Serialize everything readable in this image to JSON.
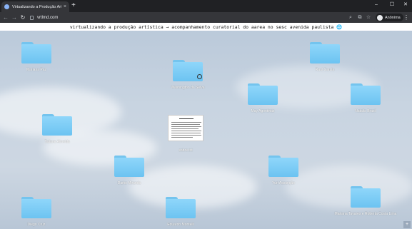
{
  "browser": {
    "tab_title": "Virtualizando a Produção Artística",
    "new_tab_label": "+",
    "close_tab_label": "×",
    "url": "vrtlmd.com",
    "profile_name": "Anônima",
    "window_controls": {
      "minimize": "–",
      "maximize": "☐",
      "close": "✕"
    },
    "nav_icons": {
      "back": "←",
      "forward": "→",
      "reload": "↻"
    },
    "toolbar_icons": {
      "search": "⌕",
      "cast": "⧉",
      "bookmark": "☆",
      "menu": "⋮"
    }
  },
  "page": {
    "banner_text": "virtualizando a produção artística → acompanhamento curatorial do aarea no sesc avenida paulista 🌐",
    "folders": [
      "Mariana Paz",
      "Washington da Selva",
      "Raul Garcia",
      "May Agontinas",
      "Natalia Brasil",
      "Tatiane Almeida",
      "Darks Miranda",
      "Yuri Assunção",
      "Mariana Tavares e Roberta Costa Lima",
      "Diego Cruz",
      "Eduardo Montelli"
    ],
    "document_label": "sobre.txt",
    "corner_button": "+"
  },
  "colors": {
    "folder": "#6cc3f1",
    "banner_bg": "#ffffff",
    "chrome_bg": "#202124"
  }
}
